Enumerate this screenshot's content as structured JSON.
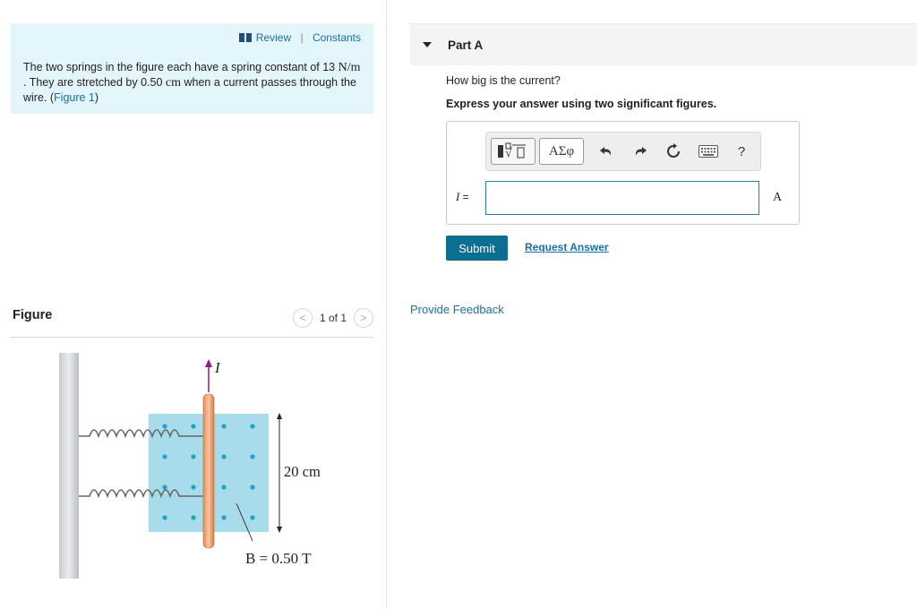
{
  "problem": {
    "review_label": "Review",
    "constants_label": "Constants",
    "text_1": "The two springs in the figure each have a spring constant of 13 ",
    "unit_k": "N/m",
    "text_2": " . They are stretched by 0.50 ",
    "unit_cm": "cm",
    "text_3": " when a current passes through the wire. (",
    "figure_link": "Figure 1",
    "text_4": ")"
  },
  "figure": {
    "title": "Figure",
    "pager": "1 of 1",
    "prev_icon": "chevron-left-icon",
    "next_icon": "chevron-right-icon",
    "current_label": "I",
    "height_label": "20 cm",
    "field_label": "B = 0.50 T"
  },
  "part": {
    "title": "Part A",
    "question": "How big is the current?",
    "instruction": "Express your answer using two significant figures.",
    "variable": "I",
    "equals": " =",
    "unit": "A",
    "input_value": "",
    "submit_label": "Submit",
    "request_label": "Request Answer",
    "greek_label": "ΑΣφ",
    "help_label": "?"
  },
  "feedback_label": "Provide Feedback",
  "colors": {
    "accent": "#0b6e92",
    "link": "#1a6fa6",
    "panel_bg": "#e3f5fa",
    "field_bg": "#a8dcea",
    "wire": "#f2a77a"
  }
}
